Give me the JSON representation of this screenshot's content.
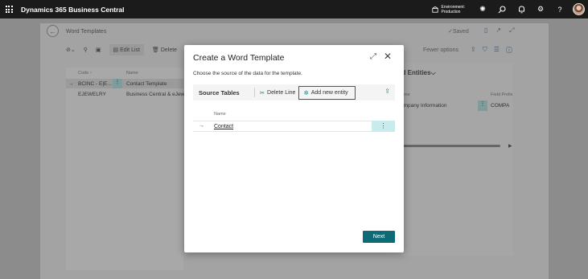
{
  "topbar": {
    "app_title": "Dynamics 365 Business Central",
    "environment_label": "Environment:",
    "environment_value": "Production",
    "icons": [
      "waffle-icon",
      "environment-icon",
      "copilot-icon",
      "search-icon",
      "bell-icon",
      "gear-icon",
      "help-icon"
    ]
  },
  "background_page": {
    "title": "Word Templates",
    "saved_label": "✓Saved",
    "toolbar": {
      "edit_list": "Edit List",
      "delete": "Delete"
    },
    "list": {
      "col_code": "Code ↑",
      "col_name": "Name",
      "rows": [
        {
          "code": "BCINC - E|E...",
          "name": "Contact Template"
        },
        {
          "code": "EJEWELRY",
          "name": "Business Central & eJew..."
        }
      ]
    },
    "fewer_options": "Fewer options",
    "related_entities_title": "ated Entities",
    "related_entities_col_name": "me",
    "related_entities_col_prefix": "Field Prefix",
    "related_entity_row": "ompany Information",
    "related_entity_prefix": "COMPA"
  },
  "dialog": {
    "title": "Create a Word Template",
    "description": "Choose the source of the data for the template.",
    "source_tables_title": "Source Tables",
    "delete_line": "Delete Line",
    "add_new_entity": "Add new entity",
    "column_name": "Name",
    "rows": [
      {
        "name": "Contact"
      }
    ],
    "next_button": "Next"
  },
  "colors": {
    "topbar": "#1b1b1b",
    "accent": "#0e6b75",
    "highlight_box": "#d0211c",
    "selected_cell": "#c8ecec"
  }
}
